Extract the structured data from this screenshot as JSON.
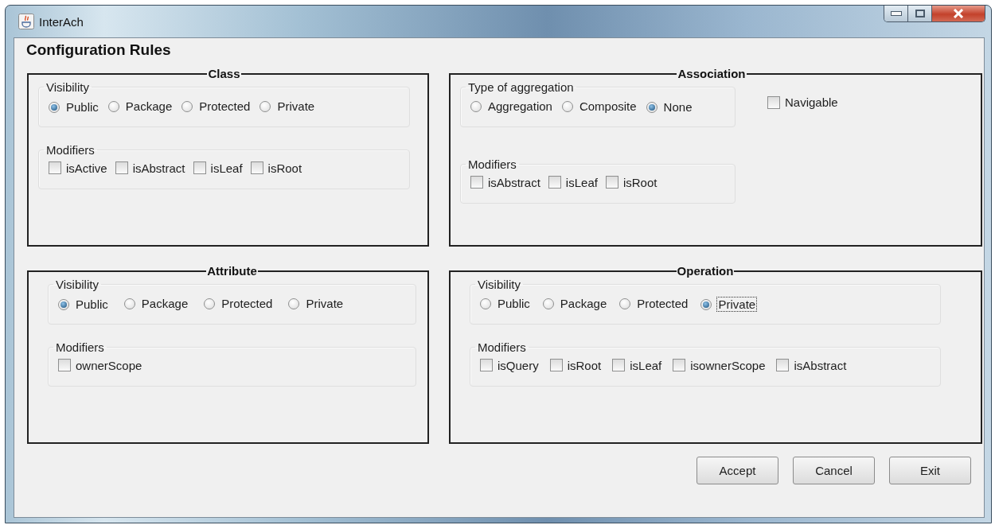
{
  "window": {
    "title": "InterAch"
  },
  "heading": "Configuration Rules",
  "panels": [
    {
      "title": "Class",
      "rows": [
        [
          {
            "kind": "radio-group",
            "title": "Visibility",
            "options": [
              {
                "label": "Public",
                "selected": true
              },
              {
                "label": "Package",
                "selected": false
              },
              {
                "label": "Protected",
                "selected": false
              },
              {
                "label": "Private",
                "selected": false
              }
            ]
          }
        ],
        [
          {
            "kind": "checkbox-group",
            "title": "Modifiers",
            "options": [
              {
                "label": "isActive",
                "checked": false
              },
              {
                "label": "isAbstract",
                "checked": false
              },
              {
                "label": "isLeaf",
                "checked": false
              },
              {
                "label": "isRoot",
                "checked": false
              }
            ]
          }
        ]
      ]
    },
    {
      "title": "Association",
      "rows": [
        [
          {
            "kind": "radio-group",
            "title": "Type of aggregation",
            "options": [
              {
                "label": "Aggregation",
                "selected": false
              },
              {
                "label": "Composite",
                "selected": false
              },
              {
                "label": "None",
                "selected": true
              }
            ]
          },
          {
            "kind": "checkbox",
            "label": "Navigable",
            "checked": false
          }
        ],
        [
          {
            "kind": "checkbox-group",
            "title": "Modifiers",
            "options": [
              {
                "label": "isAbstract",
                "checked": false
              },
              {
                "label": "isLeaf",
                "checked": false
              },
              {
                "label": "isRoot",
                "checked": false
              }
            ]
          }
        ]
      ]
    },
    {
      "title": "Attribute",
      "rows": [
        [
          {
            "kind": "radio-group",
            "title": "Visibility",
            "options": [
              {
                "label": "Public",
                "selected": true
              },
              {
                "label": "Package",
                "selected": false
              },
              {
                "label": "Protected",
                "selected": false
              },
              {
                "label": "Private",
                "selected": false
              }
            ]
          }
        ],
        [
          {
            "kind": "checkbox-group",
            "title": "Modifiers",
            "options": [
              {
                "label": "ownerScope",
                "checked": false
              }
            ]
          }
        ]
      ]
    },
    {
      "title": "Operation",
      "rows": [
        [
          {
            "kind": "radio-group",
            "title": "Visibility",
            "options": [
              {
                "label": "Public",
                "selected": false,
                "focused": false
              },
              {
                "label": "Package",
                "selected": false,
                "focused": false
              },
              {
                "label": "Protected",
                "selected": false,
                "focused": false
              },
              {
                "label": "Private",
                "selected": true,
                "focused": true
              }
            ]
          }
        ],
        [
          {
            "kind": "checkbox-group",
            "title": "Modifiers",
            "options": [
              {
                "label": "isQuery",
                "checked": false
              },
              {
                "label": "isRoot",
                "checked": false
              },
              {
                "label": "isLeaf",
                "checked": false
              },
              {
                "label": "isownerScope",
                "checked": false
              },
              {
                "label": "isAbstract",
                "checked": false
              }
            ]
          }
        ]
      ]
    }
  ],
  "buttons": [
    "Accept",
    "Cancel",
    "Exit"
  ]
}
